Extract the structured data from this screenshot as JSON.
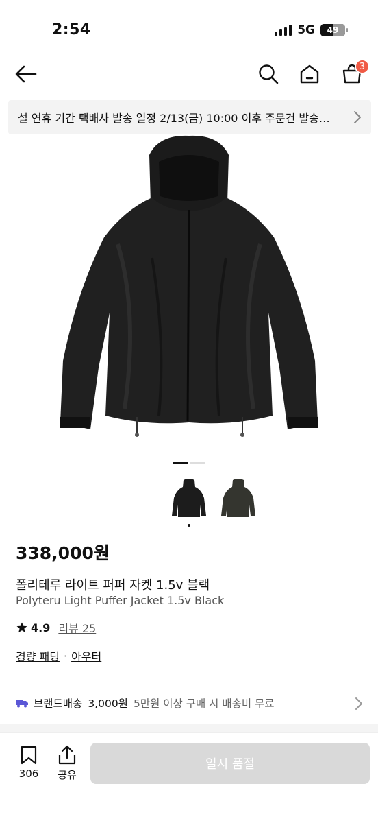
{
  "status": {
    "time": "2:54",
    "network": "5G",
    "battery": "49"
  },
  "nav": {
    "cart_count": "3"
  },
  "notice": {
    "text": "설 연휴 기간 택배사 발송 일정 2/13(금) 10:00 이후 주문건 발송…"
  },
  "gallery": {
    "page_count": 2,
    "active_page": 1
  },
  "product": {
    "price": "338,000원",
    "title_ko": "폴리테루 라이트 퍼퍼 자켓 1.5v 블랙",
    "title_en": "Polyteru Light Puffer Jacket 1.5v Black",
    "rating": "4.9",
    "reviews": "리뷰 25",
    "categories": [
      "경량 패딩",
      "아우터"
    ],
    "category_sep": "·"
  },
  "shipping": {
    "label": "브랜드배송",
    "fee": "3,000원",
    "note": "5만원 이상 구매 시 배송비 무료"
  },
  "bottom": {
    "like_count": "306",
    "share_label": "공유",
    "buy_label": "일시 품절"
  },
  "colors": {
    "accent": "#f05a45",
    "shipping_icon": "#5b57d6",
    "disabled_button": "#d9d9d9"
  }
}
